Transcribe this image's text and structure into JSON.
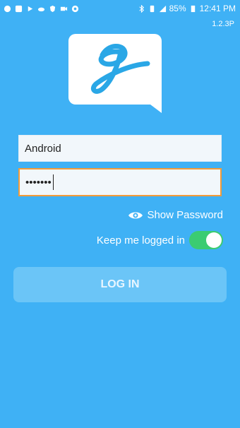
{
  "status_bar": {
    "battery": "85%",
    "time": "12:41 PM"
  },
  "app": {
    "version": "1.2.3P"
  },
  "login_form": {
    "username_value": "Android",
    "password_value": "•••••••",
    "show_password_label": "Show Password",
    "keep_logged_in_label": "Keep me logged in",
    "keep_logged_in_enabled": true,
    "login_button_label": "LOG IN"
  },
  "colors": {
    "background": "#3fb1f5",
    "toggle_on": "#3bcc72",
    "focus_border": "#f29b3a",
    "button": "#6bc5f7"
  }
}
